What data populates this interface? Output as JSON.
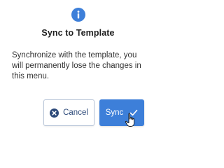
{
  "dialog": {
    "icon": "info-icon",
    "title": "Sync to Template",
    "message": "Synchronize with the template, you will permanently lose the changes in this menu.",
    "cancel_label": "Cancel",
    "cancel_icon": "cancel-circle-icon",
    "sync_label": "Sync",
    "sync_icon": "check-icon"
  },
  "colors": {
    "accent": "#3d7fd9",
    "info_icon": "#3d7fd9",
    "cancel_text": "#2d4a7a"
  }
}
